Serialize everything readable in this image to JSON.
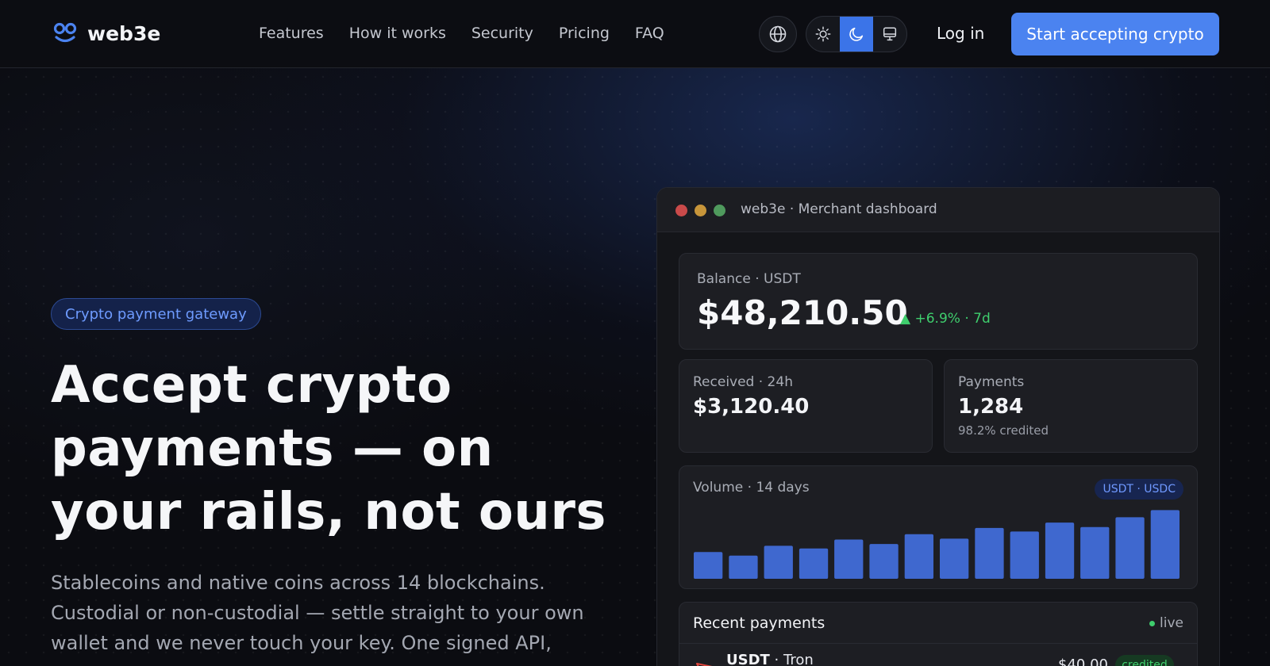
{
  "brand": {
    "name": "web3e"
  },
  "nav": {
    "links": [
      "Features",
      "How it works",
      "Security",
      "Pricing",
      "FAQ"
    ],
    "login": "Log in",
    "cta": "Start accepting crypto",
    "icons": {
      "language": "globe-icon",
      "light": "sun-icon",
      "dark": "moon-icon",
      "system": "monitor-icon"
    },
    "theme_active": "dark"
  },
  "hero": {
    "badge": "Crypto payment gateway",
    "title": "Accept crypto payments — on your rails, not ours",
    "subtitle": "Stablecoins and native coins across 14 blockchains. Custodial or non-custodial — settle straight to your own wallet and we never touch your key. One signed API,"
  },
  "dashboard": {
    "window_title": "web3e · Merchant dashboard",
    "balance": {
      "label": "Balance · USDT",
      "amount": "$48,210.50",
      "change": "▲ +6.9% · 7d"
    },
    "received": {
      "label": "Received · 24h",
      "value": "$3,120.40"
    },
    "payments": {
      "label": "Payments",
      "value": "1,284",
      "sub": "98.2% credited"
    },
    "volume": {
      "label": "Volume · 14 days",
      "tag": "USDT · USDC"
    },
    "recent": {
      "title": "Recent payments",
      "live": "live",
      "rows": [
        {
          "coin": "USDT",
          "network": "Tron",
          "amount": "$40.00",
          "status": "credited"
        }
      ]
    }
  },
  "chart_data": {
    "type": "bar",
    "title": "Volume · 14 days",
    "values": [
      30,
      26,
      37,
      34,
      44,
      39,
      50,
      45,
      57,
      53,
      63,
      58,
      69,
      77
    ],
    "ylim": [
      0,
      80
    ],
    "color": "#3f68cf"
  },
  "colors": {
    "accent": "#4b83f0",
    "positive": "#3fce6d",
    "badge_text": "#6e9bff"
  }
}
